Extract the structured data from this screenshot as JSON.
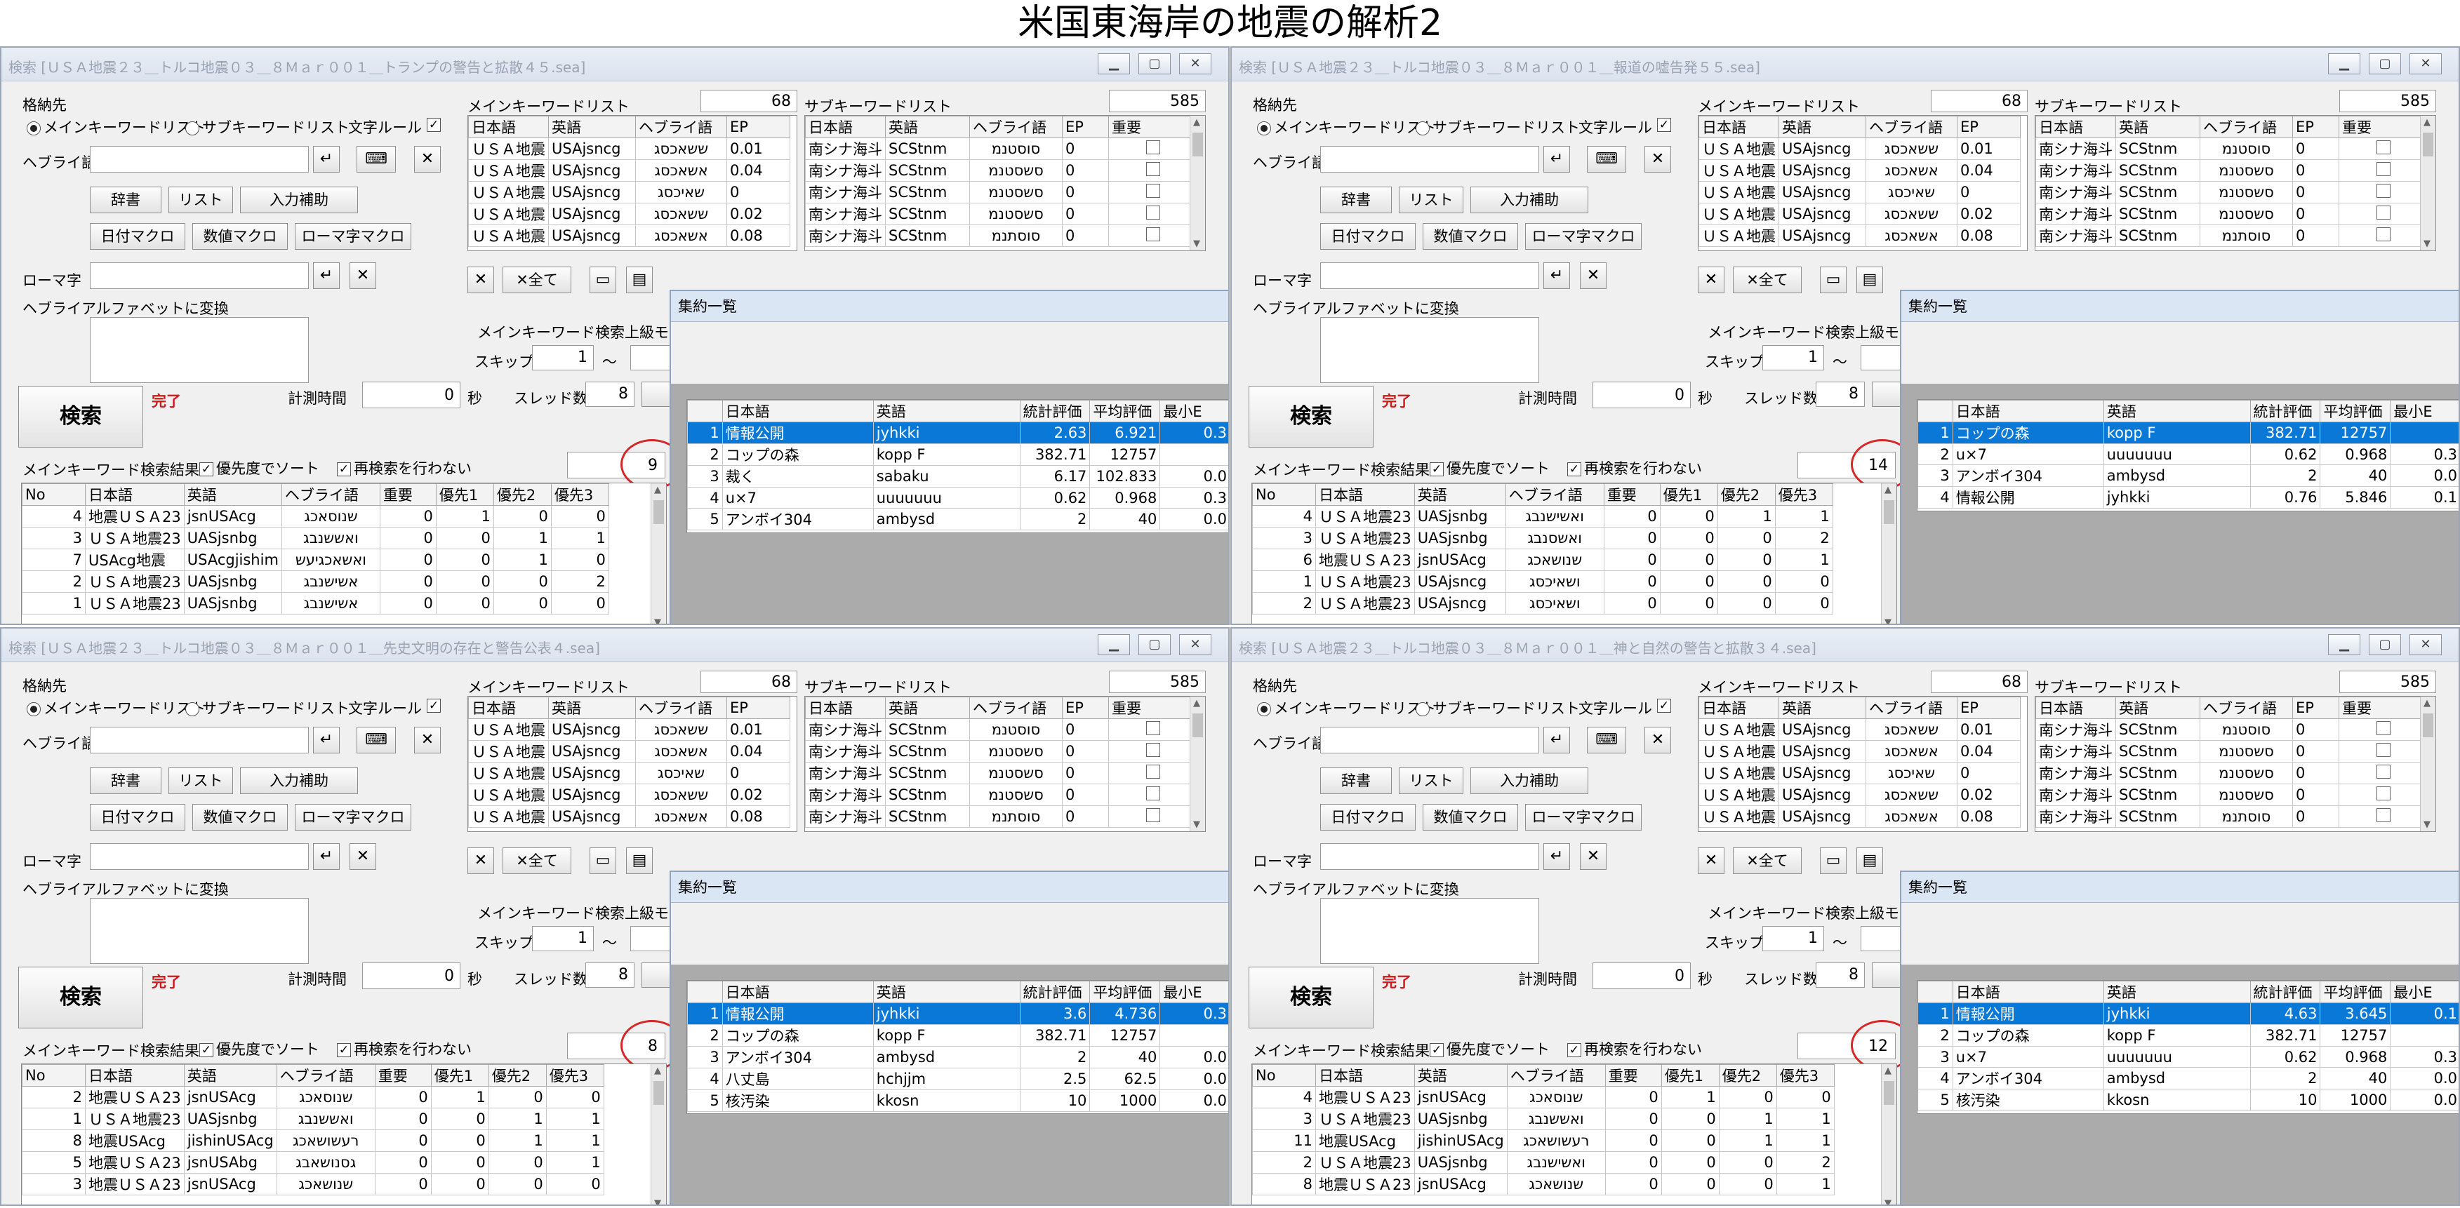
{
  "page_title": "米国東海岸の地震の解析2",
  "common": {
    "storage_label": "格納先",
    "radio_main": "メインキーワードリスト",
    "radio_sub": "サブキーワードリスト",
    "char_rule": "文字ルール",
    "hebrew_label": "ヘブライ語",
    "btn_dict": "辞書",
    "btn_list": "リスト",
    "btn_input_assist": "入力補助",
    "btn_date_macro": "日付マクロ",
    "btn_num_macro": "数値マクロ",
    "btn_romaji_macro": "ローマ字マクロ",
    "romaji_label": "ローマ字",
    "convert_label": "ヘブライアルファベットに変換",
    "search_button": "検索",
    "status": "完了",
    "time_label": "計測時間",
    "time_value": "0",
    "sec_label": "秒",
    "main_list_title": "メインキーワードリスト",
    "main_count": "68",
    "sub_list_title": "サブキーワードリスト",
    "sub_count": "585",
    "clear_all": "全て",
    "adv_mode": "メインキーワード検索上級モード",
    "skip_label": "スキップ",
    "skip_value": "1",
    "tilde": "～",
    "thread_label": "スレッド数",
    "thread_value": "8",
    "results_label": "メインキーワード検索結果",
    "sort_priority": "優先度でソート",
    "no_research": "再検索を行わない",
    "summary_title": "集約一覧",
    "main_headers": [
      "日本語",
      "英語",
      "ヘブライ語",
      "EP"
    ],
    "main_rows": [
      [
        "ＵＳＡ地震",
        "USAjsncg",
        "ששאכסג",
        "0.01"
      ],
      [
        "ＵＳＡ地震",
        "USAjsncg",
        "אשאכסג",
        "0.04"
      ],
      [
        "ＵＳＡ地震",
        "USAjsncg",
        "שאיכסג",
        "0"
      ],
      [
        "ＵＳＡ地震",
        "USAjsncg",
        "ששאכסג",
        "0.02"
      ],
      [
        "ＵＳＡ地震",
        "USAjsncg",
        "אשאכסג",
        "0.08"
      ]
    ],
    "sub_headers": [
      "日本語",
      "英語",
      "ヘブライ語",
      "EP",
      "重要"
    ],
    "sub_rows": [
      [
        "南シナ海斗",
        "SCStnm",
        "סוסטנמ",
        "0"
      ],
      [
        "南シナ海斗",
        "SCStnm",
        "סשסטנמ",
        "0"
      ],
      [
        "南シナ海斗",
        "SCStnm",
        "סשסטנמ",
        "0"
      ],
      [
        "南シナ海斗",
        "SCStnm",
        "סשסטנמ",
        "0"
      ],
      [
        "南シナ海斗",
        "SCStnm",
        "סוסתנמ",
        "0"
      ]
    ],
    "result_headers": [
      "No",
      "日本語",
      "英語",
      "ヘブライ語",
      "重要",
      "優先1",
      "優先2",
      "優先3"
    ],
    "summary_headers": [
      "日本語",
      "英語",
      "統計評価",
      "平均評価",
      "最小E"
    ]
  },
  "windows": [
    {
      "title": "検索 [ＵＳＡ地震２３＿トルコ地震０３＿８Ｍａｒ００１＿トランプの警告と拡散４５.sea]",
      "result_count": "9",
      "results": [
        [
          "4",
          "地震ＵＳＡ23",
          "jsnUSAcg",
          "שנוסאכג",
          "0",
          "1",
          "0",
          "0"
        ],
        [
          "3",
          "ＵＳＡ地震23",
          "UASjsnbg",
          "ואששנבג",
          "0",
          "0",
          "1",
          "1"
        ],
        [
          "7",
          "USAcg地震",
          "USAcgjishim",
          "ואשאכגיעש",
          "0",
          "0",
          "1",
          "0"
        ],
        [
          "2",
          "ＵＳＡ地震23",
          "UASjsnbg",
          "אשישנבג",
          "0",
          "0",
          "0",
          "2"
        ],
        [
          "1",
          "ＵＳＡ地震23",
          "UASjsnbg",
          "אשישנבג",
          "0",
          "0",
          "0",
          "0"
        ]
      ],
      "summary": [
        [
          "1",
          "情報公開",
          "jyhkki",
          "2.63",
          "6.921",
          "0.3"
        ],
        [
          "2",
          "コップの森",
          "kopp F",
          "382.71",
          "12757",
          ""
        ],
        [
          "3",
          "裁く",
          "sabaku",
          "6.17",
          "102.833",
          "0.0"
        ],
        [
          "4",
          "u×7",
          "uuuuuuu",
          "0.62",
          "0.968",
          "0.3"
        ],
        [
          "5",
          "アンボイ304",
          "ambysd",
          "2",
          "40",
          "0.0"
        ]
      ],
      "selected": 0
    },
    {
      "title": "検索 [ＵＳＡ地震２３＿トルコ地震０３＿８Ｍａｒ００１＿報道の嘘告発５５.sea]",
      "result_count": "14",
      "results": [
        [
          "4",
          "ＵＳＡ地震23",
          "UASjsnbg",
          "ואשישנבג",
          "0",
          "0",
          "1",
          "1"
        ],
        [
          "3",
          "ＵＳＡ地震23",
          "UASjsnbg",
          "ואשסנבג",
          "0",
          "0",
          "0",
          "2"
        ],
        [
          "6",
          "地震ＵＳＡ23",
          "jsnUSAcg",
          "שנושאכג",
          "0",
          "0",
          "0",
          "1"
        ],
        [
          "1",
          "ＵＳＡ地震23",
          "USAjsncg",
          "ושאיכסג",
          "0",
          "0",
          "0",
          "0"
        ],
        [
          "2",
          "ＵＳＡ地震23",
          "USAjsncg",
          "ושאיכסג",
          "0",
          "0",
          "0",
          "0"
        ]
      ],
      "summary": [
        [
          "1",
          "コップの森",
          "kopp F",
          "382.71",
          "12757",
          ""
        ],
        [
          "2",
          "u×7",
          "uuuuuuu",
          "0.62",
          "0.968",
          "0.3"
        ],
        [
          "3",
          "アンボイ304",
          "ambysd",
          "2",
          "40",
          "0.0"
        ],
        [
          "4",
          "情報公開",
          "jyhkki",
          "0.76",
          "5.846",
          "0.1"
        ]
      ],
      "selected": 0
    },
    {
      "title": "検索 [ＵＳＡ地震２３＿トルコ地震０３＿８Ｍａｒ００１＿先史文明の存在と警告公表４.sea]",
      "result_count": "8",
      "results": [
        [
          "2",
          "地震ＵＳＡ23",
          "jsnUSAcg",
          "שנוסאכג",
          "0",
          "1",
          "0",
          "0"
        ],
        [
          "1",
          "ＵＳＡ地震23",
          "UASjsnbg",
          "ואששנבג",
          "0",
          "0",
          "1",
          "1"
        ],
        [
          "8",
          "地震USAcg",
          "jishinUSAcg",
          "רעשושאכג",
          "0",
          "0",
          "1",
          "1"
        ],
        [
          "5",
          "地震ＵＳＡ23",
          "jsnUSAbg",
          "גסנושאבג",
          "0",
          "0",
          "0",
          "1"
        ],
        [
          "3",
          "地震ＵＳＡ23",
          "jsnUSAcg",
          "שנושאכג",
          "0",
          "0",
          "0",
          "0"
        ]
      ],
      "summary": [
        [
          "1",
          "情報公開",
          "jyhkki",
          "3.6",
          "4.736",
          "0.3"
        ],
        [
          "2",
          "コップの森",
          "kopp F",
          "382.71",
          "12757",
          ""
        ],
        [
          "3",
          "アンボイ304",
          "ambysd",
          "2",
          "40",
          "0.0"
        ],
        [
          "4",
          "八丈島",
          "hchjjm",
          "2.5",
          "62.5",
          "0.0"
        ],
        [
          "5",
          "核汚染",
          "kkosn",
          "10",
          "1000",
          "0.0"
        ]
      ],
      "selected": 0
    },
    {
      "title": "検索 [ＵＳＡ地震２３＿トルコ地震０３＿８Ｍａｒ００１＿神と自然の警告と拡散３４.sea]",
      "result_count": "12",
      "results": [
        [
          "4",
          "地震ＵＳＡ23",
          "jsnUSAcg",
          "שנוסאכג",
          "0",
          "1",
          "0",
          "0"
        ],
        [
          "3",
          "ＵＳＡ地震23",
          "UASjsnbg",
          "ואששנבג",
          "0",
          "0",
          "1",
          "1"
        ],
        [
          "11",
          "地震USAcg",
          "jishinUSAcg",
          "רעשושאכג",
          "0",
          "0",
          "1",
          "1"
        ],
        [
          "2",
          "ＵＳＡ地震23",
          "UASjsnbg",
          "ואשישנבג",
          "0",
          "0",
          "0",
          "2"
        ],
        [
          "8",
          "地震ＵＳＡ23",
          "jsnUSAcg",
          "שנושאכג",
          "0",
          "0",
          "0",
          "1"
        ]
      ],
      "summary": [
        [
          "1",
          "情報公開",
          "jyhkki",
          "4.63",
          "3.645",
          "0.1"
        ],
        [
          "2",
          "コップの森",
          "kopp F",
          "382.71",
          "12757",
          ""
        ],
        [
          "3",
          "u×7",
          "uuuuuuu",
          "0.62",
          "0.968",
          "0.3"
        ],
        [
          "4",
          "アンボイ304",
          "ambysd",
          "2",
          "40",
          "0.0"
        ],
        [
          "5",
          "核汚染",
          "kkosn",
          "10",
          "1000",
          "0.0"
        ]
      ],
      "selected": 0
    }
  ],
  "colors": {
    "selection": "#0a78d7",
    "status": "#d01818",
    "annotation": "#d62828"
  }
}
